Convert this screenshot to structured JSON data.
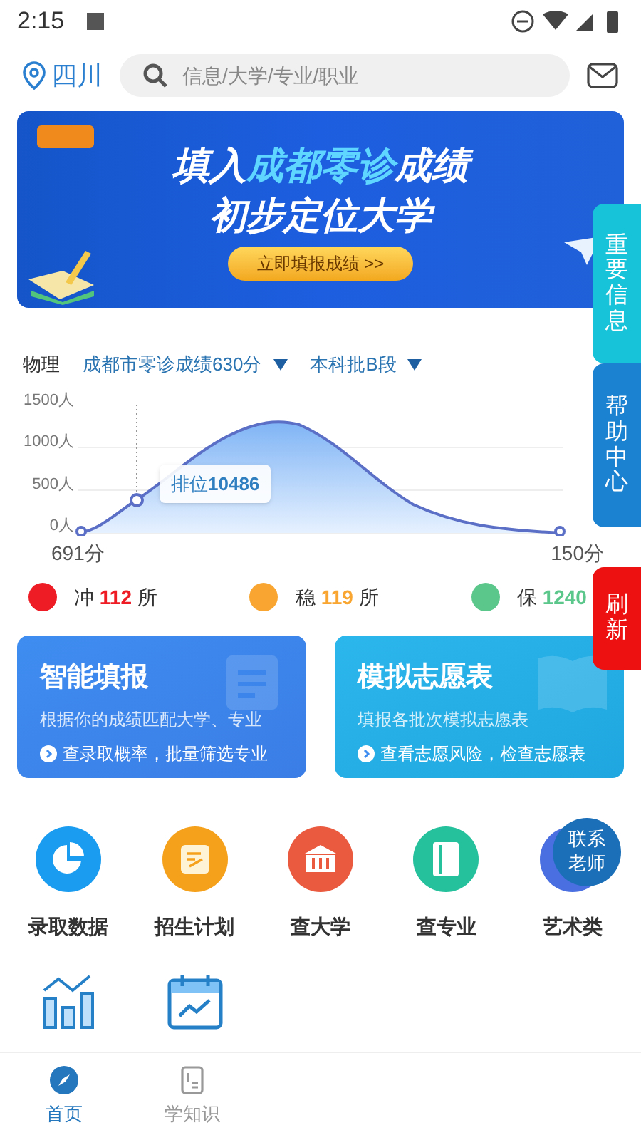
{
  "status_bar": {
    "time": "2:15"
  },
  "header": {
    "location": "四川",
    "search": {
      "placeholder": "信息/大学/专业/职业"
    }
  },
  "banner": {
    "headline": [
      {
        "text": "填入",
        "highlight": false
      },
      {
        "text": "成都零诊",
        "highlight": true
      },
      {
        "text": "成绩",
        "highlight": false
      }
    ],
    "subline": "初步定位大学",
    "button": "立即填报成绩 >>"
  },
  "filters": {
    "subject": "物理",
    "dropdowns": [
      "成都市零诊成绩630分",
      "本科批B段"
    ]
  },
  "chart": {
    "y_labels": [
      "1500人",
      "1000人",
      "500人",
      "0人"
    ],
    "x_labels": [
      "691分",
      "150分"
    ],
    "rank_label": "排位",
    "rank_value": "10486"
  },
  "legend": [
    {
      "label": "冲",
      "count": "112",
      "unit": "所",
      "color": "#ee1c25"
    },
    {
      "label": "稳",
      "count": "119",
      "unit": "所",
      "color": "#f8a631"
    },
    {
      "label": "保",
      "count": "1240",
      "color": "#5cc78b"
    }
  ],
  "cards": [
    {
      "kind": "fill",
      "title": "智能填报",
      "subtitle": "根据你的成绩匹配大学、专业",
      "link": "查录取概率，批量筛选专业"
    },
    {
      "kind": "table",
      "title": "模拟志愿表",
      "subtitle": "填报各批次模拟志愿表",
      "link": "查看志愿风险，检查志愿表"
    }
  ],
  "shortcuts": [
    {
      "kind": "pie",
      "label": "录取数据",
      "color": "#1a9df0"
    },
    {
      "kind": "plan",
      "label": "招生计划",
      "color": "#f5a11c"
    },
    {
      "kind": "school",
      "label": "查大学",
      "color": "#ea5a3f"
    },
    {
      "kind": "book",
      "label": "查专业",
      "color": "#25c09c"
    },
    {
      "kind": "art",
      "label": "艺术类",
      "color": "#4a6fe0"
    }
  ],
  "shortcuts_row2": [
    {
      "kind": "bars"
    },
    {
      "kind": "calendar"
    }
  ],
  "side_tabs": [
    {
      "kind": "info",
      "label": "重要信息"
    },
    {
      "kind": "help",
      "label": "帮助中心"
    },
    {
      "kind": "refresh",
      "label": "刷新"
    }
  ],
  "contact_bubble": "联系老师",
  "bottom_nav": [
    {
      "kind": "home",
      "label": "首页",
      "selected": true
    },
    {
      "kind": "learn",
      "label": "学知识",
      "selected": false
    }
  ]
}
